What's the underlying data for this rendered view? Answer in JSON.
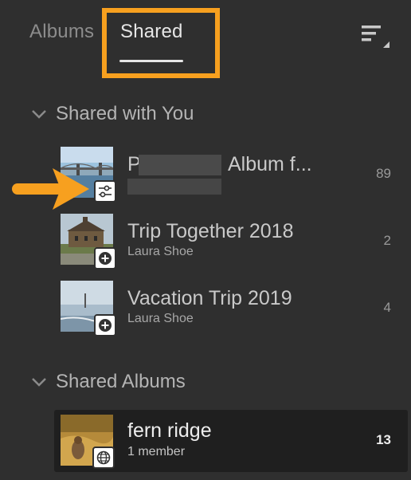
{
  "tabs": {
    "albums_label": "Albums",
    "shared_label": "Shared"
  },
  "sections": {
    "shared_with_you": {
      "title": "Shared with You",
      "items": [
        {
          "title": "P",
          "title_suffix": "Album f...",
          "count": "89",
          "badge_icon": "sliders-icon"
        },
        {
          "title": "Trip Together 2018",
          "subtitle": "Laura Shoe",
          "count": "2",
          "badge_icon": "plus-circle-icon"
        },
        {
          "title": "Vacation Trip 2019",
          "subtitle": "Laura Shoe",
          "count": "4",
          "badge_icon": "plus-circle-icon"
        }
      ]
    },
    "shared_albums": {
      "title": "Shared Albums",
      "items": [
        {
          "title": "fern ridge",
          "subtitle": "1 member",
          "count": "13",
          "badge_icon": "globe-icon"
        }
      ]
    }
  },
  "colors": {
    "background": "#2f2f2f",
    "selected_row": "#1f1f1f",
    "highlight": "#f7a01f"
  }
}
